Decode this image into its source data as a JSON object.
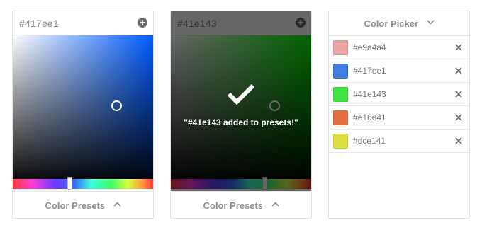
{
  "picker1": {
    "hex": "#417ee1",
    "base_hue_color": "#005cff",
    "add_icon": "plus-circle-icon",
    "footer_label": "Color Presets",
    "footer_icon": "chevron-up-icon"
  },
  "picker2": {
    "hex": "#41e143",
    "base_hue_color": "#00ff00",
    "add_icon": "plus-circle-icon",
    "toast_icon": "checkmark-icon",
    "toast_message": "\"#41e143 added to presets!\"",
    "footer_label": "Color Presets",
    "footer_icon": "chevron-up-icon"
  },
  "presets": {
    "title": "Color Picker",
    "title_icon": "chevron-down-icon",
    "items": [
      {
        "label": "#e9a4a4",
        "color": "#e9a4a4"
      },
      {
        "label": "#417ee1",
        "color": "#417ee1"
      },
      {
        "label": "#41e143",
        "color": "#41e143"
      },
      {
        "label": "#e16e41",
        "color": "#e16e41"
      },
      {
        "label": "#dce141",
        "color": "#dce141"
      }
    ],
    "remove_icon": "close-icon"
  }
}
